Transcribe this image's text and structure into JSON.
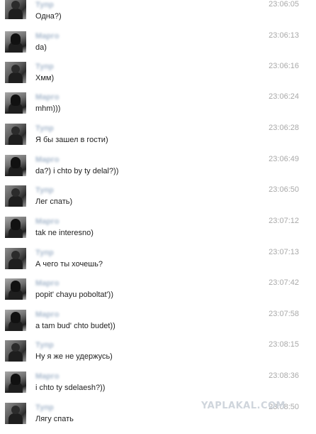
{
  "messages": [
    {
      "name": "Тупр",
      "time": "23:06:05",
      "text": "Одна?)",
      "avatar": "male"
    },
    {
      "name": "Маргo",
      "time": "23:06:13",
      "text": "da)",
      "avatar": "female"
    },
    {
      "name": "Тупр",
      "time": "23:06:16",
      "text": "Хмм)",
      "avatar": "male"
    },
    {
      "name": "Маргo",
      "time": "23:06:24",
      "text": "mhm)))",
      "avatar": "female"
    },
    {
      "name": "Тупр",
      "time": "23:06:28",
      "text": "Я бы зашел в гости)",
      "avatar": "male"
    },
    {
      "name": "Маргo",
      "time": "23:06:49",
      "text": "da?) i chto by ty delal?))",
      "avatar": "female"
    },
    {
      "name": "Тупр",
      "time": "23:06:50",
      "text": "Лег спать)",
      "avatar": "male"
    },
    {
      "name": "Маргo",
      "time": "23:07:12",
      "text": "tak ne interesno)",
      "avatar": "female"
    },
    {
      "name": "Тупр",
      "time": "23:07:13",
      "text": "А чего ты хочешь?",
      "avatar": "male"
    },
    {
      "name": "Маргo",
      "time": "23:07:42",
      "text": "popit' chayu poboltat'))",
      "avatar": "female"
    },
    {
      "name": "Маргo",
      "time": "23:07:58",
      "text": "a tam bud' chto budet))",
      "avatar": "female"
    },
    {
      "name": "Тупр",
      "time": "23:08:15",
      "text": "Ну я же не удержусь)",
      "avatar": "male"
    },
    {
      "name": "Маргo",
      "time": "23:08:36",
      "text": "i chto ty sdelaesh?))",
      "avatar": "female"
    },
    {
      "name": "Тупр",
      "time": "23:08:50",
      "text": "Лягу спать",
      "avatar": "male"
    }
  ],
  "watermark": "YAPLAKAL.COM"
}
